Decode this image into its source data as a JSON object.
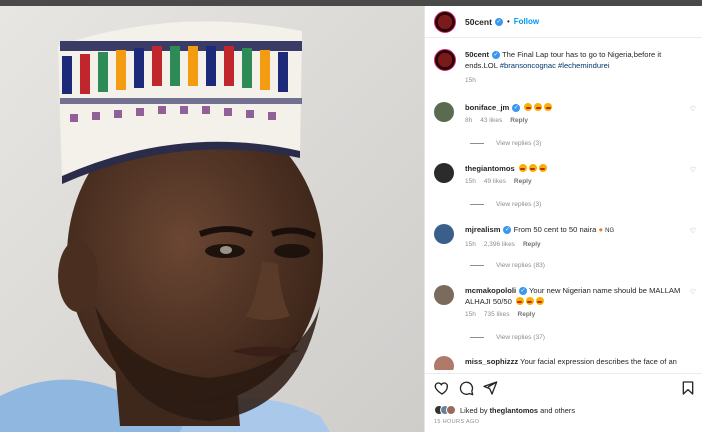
{
  "post": {
    "author": "50cent",
    "follow_label": "Follow",
    "separator": "•",
    "caption_user": "50cent",
    "caption_text": " The Final Lap tour has to go to Nigeria,before it ends.LOL ",
    "caption_tags": "#bransoncognac #lechemindurei",
    "caption_time": "15h"
  },
  "comments": [
    {
      "user": "boniface_jm",
      "text": "",
      "time": "8h",
      "likes": "43 likes",
      "reply": "Reply",
      "view_replies": "View replies (3)"
    },
    {
      "user": "thegiantomos",
      "text": "",
      "time": "15h",
      "likes": "49 likes",
      "reply": "Reply",
      "view_replies": "View replies (3)"
    },
    {
      "user": "mjrealism",
      "text": "From 50 cent to 50 naira",
      "suffix": "NG",
      "time": "15h",
      "likes": "2,396 likes",
      "reply": "Reply",
      "view_replies": "View replies (83)"
    },
    {
      "user": "mcmakopololi",
      "text": "Your new Nigerian name should be MALLAM ALHAJI 50/50",
      "time": "15h",
      "likes": "735 likes",
      "reply": "Reply",
      "view_replies": "View replies (37)"
    },
    {
      "user": "miss_sophizzz",
      "text": "Your facial expression describes the face of an"
    }
  ],
  "footer": {
    "liked_by_prefix": "Liked by ",
    "liked_by_user": "theglantomos",
    "liked_by_suffix": " and others",
    "date": "15 HOURS AGO"
  },
  "icons": {
    "heart": "heart-icon",
    "comment": "comment-icon",
    "share": "share-icon",
    "save": "bookmark-icon"
  },
  "colors": {
    "accent": "#0095f6",
    "verified": "#3897f0",
    "text": "#262626",
    "muted": "#8e8e8e"
  }
}
